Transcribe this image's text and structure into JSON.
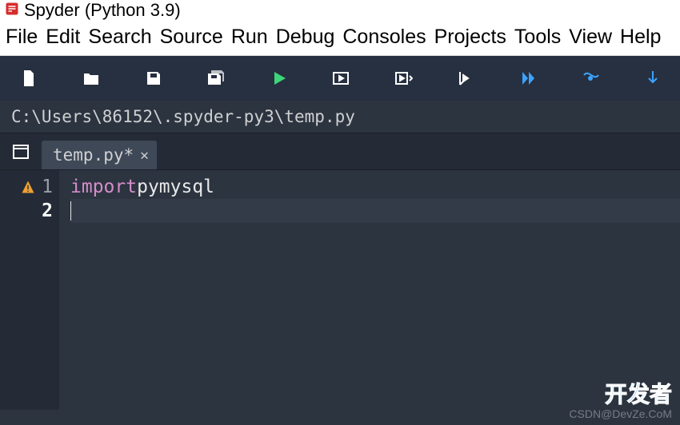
{
  "window": {
    "title": "Spyder (Python 3.9)"
  },
  "menu": {
    "items": [
      "File",
      "Edit",
      "Search",
      "Source",
      "Run",
      "Debug",
      "Consoles",
      "Projects",
      "Tools",
      "View",
      "Help"
    ]
  },
  "path": "C:\\Users\\86152\\.spyder-py3\\temp.py",
  "tab": {
    "name": "temp.py*"
  },
  "editor": {
    "lines": [
      {
        "num": "1",
        "warn": true,
        "tokens": [
          {
            "t": "kw",
            "v": "import"
          },
          {
            "t": "sp",
            "v": " "
          },
          {
            "t": "plain",
            "v": "pymysql"
          }
        ]
      },
      {
        "num": "2",
        "warn": false,
        "active": true,
        "tokens": []
      }
    ]
  },
  "watermark": {
    "cn": "开发者",
    "text": "CSDN@DevZe.CoM"
  }
}
